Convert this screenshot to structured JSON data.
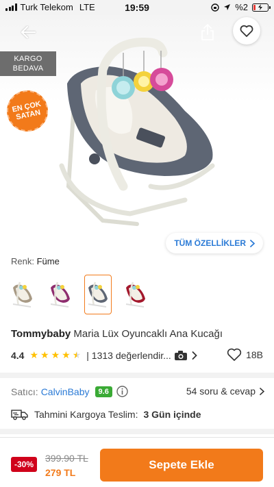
{
  "status_bar": {
    "carrier": "Turk Telekom",
    "network": "LTE",
    "time": "19:59",
    "battery": "%2"
  },
  "hero": {
    "cargo_badge_line1": "KARGO",
    "cargo_badge_line2": "BEDAVA",
    "best_seller_line1": "EN ÇOK",
    "best_seller_line2": "SATAN"
  },
  "features_button": "TÜM ÖZELLİKLER",
  "color": {
    "label": "Renk:",
    "value": "Füme",
    "variants": [
      "beige",
      "purple",
      "grey",
      "red"
    ],
    "selected_index": 2
  },
  "product": {
    "brand": "Tommybaby",
    "name": "Maria Lüx Oyuncaklı Ana Kucağı",
    "rating": "4.4",
    "rating_value": 4.4,
    "reviews": "| 1313 değerlendir...",
    "likes": "18B"
  },
  "seller": {
    "label": "Satıcı:",
    "name": "CalvinBaby",
    "score": "9.6",
    "qa": "54 soru & cevap"
  },
  "delivery": {
    "label": "Tahmini Kargoya Teslim:",
    "value": "3 Gün içinde"
  },
  "pricing": {
    "discount": "-30%",
    "old_price": "399.90 TL",
    "new_price": "279 TL",
    "add_to_cart": "Sepete Ekle"
  },
  "colors": {
    "accent": "#f27a1a",
    "link": "#2a7ad6",
    "score_green": "#3aaa35",
    "discount_red": "#d0021b"
  }
}
